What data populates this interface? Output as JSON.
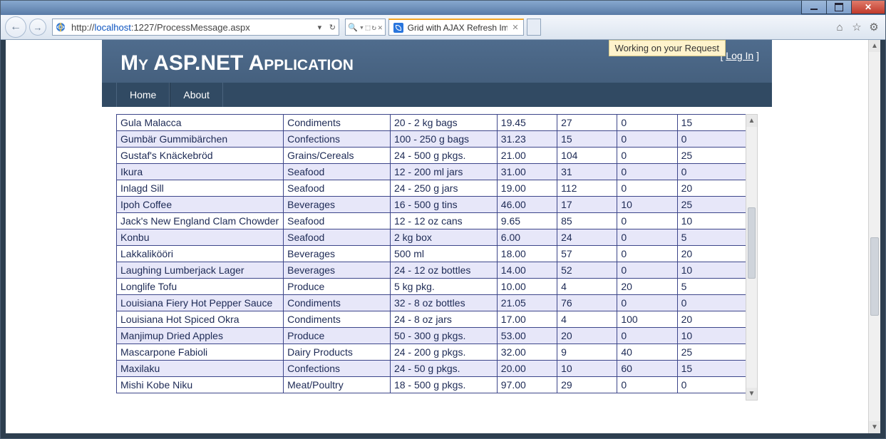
{
  "window": {
    "tab_title": "Grid with AJAX Refresh Ima...",
    "url_prefix": "http://",
    "url_host": "localhost",
    "url_port": ":1227",
    "url_path": "/ProcessMessage.aspx"
  },
  "notice": "Working on your Request",
  "app_title": "My ASP.NET Application",
  "login": {
    "left": "[ ",
    "link": "Log In",
    "right": " ]"
  },
  "nav": {
    "home": "Home",
    "about": "About"
  },
  "rows": [
    {
      "name": "Gula Malacca",
      "cat": "Condiments",
      "qty": "20 - 2 kg bags",
      "price": "19.45",
      "stock": "27",
      "order": "0",
      "reorder": "15"
    },
    {
      "name": "Gumbär Gummibärchen",
      "cat": "Confections",
      "qty": "100 - 250 g bags",
      "price": "31.23",
      "stock": "15",
      "order": "0",
      "reorder": "0"
    },
    {
      "name": "Gustaf's Knäckebröd",
      "cat": "Grains/Cereals",
      "qty": "24 - 500 g pkgs.",
      "price": "21.00",
      "stock": "104",
      "order": "0",
      "reorder": "25"
    },
    {
      "name": "Ikura",
      "cat": "Seafood",
      "qty": "12 - 200 ml jars",
      "price": "31.00",
      "stock": "31",
      "order": "0",
      "reorder": "0"
    },
    {
      "name": "Inlagd Sill",
      "cat": "Seafood",
      "qty": "24 - 250 g jars",
      "price": "19.00",
      "stock": "112",
      "order": "0",
      "reorder": "20"
    },
    {
      "name": "Ipoh Coffee",
      "cat": "Beverages",
      "qty": "16 - 500 g tins",
      "price": "46.00",
      "stock": "17",
      "order": "10",
      "reorder": "25"
    },
    {
      "name": "Jack's New England Clam Chowder",
      "cat": "Seafood",
      "qty": "12 - 12 oz cans",
      "price": "9.65",
      "stock": "85",
      "order": "0",
      "reorder": "10"
    },
    {
      "name": "Konbu",
      "cat": "Seafood",
      "qty": "2 kg box",
      "price": "6.00",
      "stock": "24",
      "order": "0",
      "reorder": "5"
    },
    {
      "name": "Lakkalikööri",
      "cat": "Beverages",
      "qty": "500 ml",
      "price": "18.00",
      "stock": "57",
      "order": "0",
      "reorder": "20"
    },
    {
      "name": "Laughing Lumberjack Lager",
      "cat": "Beverages",
      "qty": "24 - 12 oz bottles",
      "price": "14.00",
      "stock": "52",
      "order": "0",
      "reorder": "10"
    },
    {
      "name": "Longlife Tofu",
      "cat": "Produce",
      "qty": "5 kg pkg.",
      "price": "10.00",
      "stock": "4",
      "order": "20",
      "reorder": "5"
    },
    {
      "name": "Louisiana Fiery Hot Pepper Sauce",
      "cat": "Condiments",
      "qty": "32 - 8 oz bottles",
      "price": "21.05",
      "stock": "76",
      "order": "0",
      "reorder": "0"
    },
    {
      "name": "Louisiana Hot Spiced Okra",
      "cat": "Condiments",
      "qty": "24 - 8 oz jars",
      "price": "17.00",
      "stock": "4",
      "order": "100",
      "reorder": "20"
    },
    {
      "name": "Manjimup Dried Apples",
      "cat": "Produce",
      "qty": "50 - 300 g pkgs.",
      "price": "53.00",
      "stock": "20",
      "order": "0",
      "reorder": "10"
    },
    {
      "name": "Mascarpone Fabioli",
      "cat": "Dairy Products",
      "qty": "24 - 200 g pkgs.",
      "price": "32.00",
      "stock": "9",
      "order": "40",
      "reorder": "25"
    },
    {
      "name": "Maxilaku",
      "cat": "Confections",
      "qty": "24 - 50 g pkgs.",
      "price": "20.00",
      "stock": "10",
      "order": "60",
      "reorder": "15"
    },
    {
      "name": "Mishi Kobe Niku",
      "cat": "Meat/Poultry",
      "qty": "18 - 500 g pkgs.",
      "price": "97.00",
      "stock": "29",
      "order": "0",
      "reorder": "0"
    }
  ]
}
